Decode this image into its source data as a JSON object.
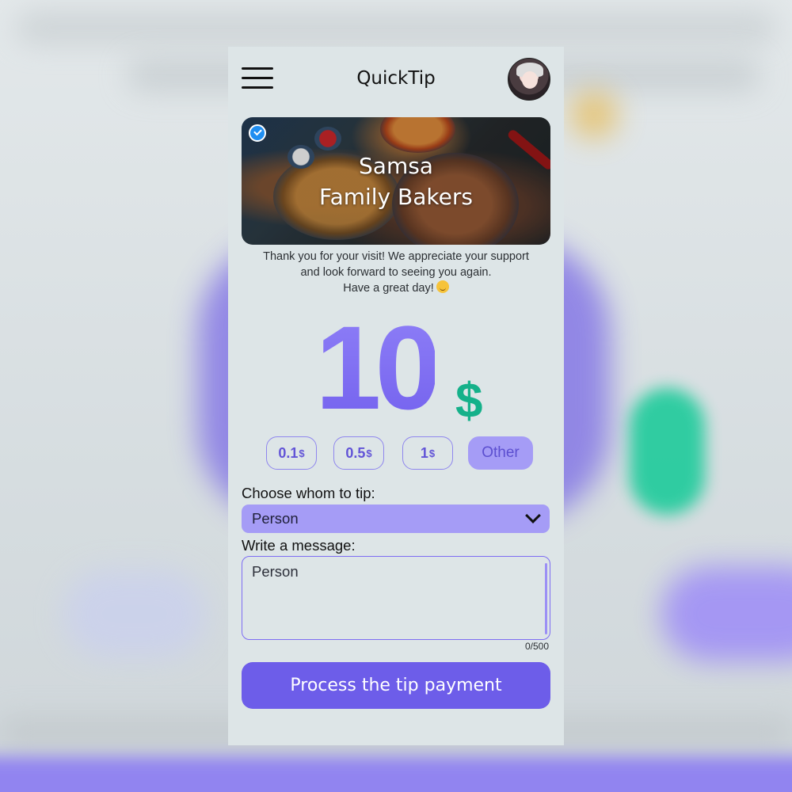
{
  "app": {
    "title": "QuickTip"
  },
  "header": {
    "menu_icon": "hamburger-menu-icon",
    "avatar_icon": "user-avatar"
  },
  "business": {
    "name_line1": "Samsa",
    "name_line2": "Family Bakers",
    "verified_icon": "verified-check-icon"
  },
  "message": {
    "line1": "Thank you for your visit! We appreciate your support",
    "line2": "and look forward to seeing you again.",
    "line3": "Have a great day!",
    "emoji_icon": "smiling-face-icon"
  },
  "tip": {
    "amount": "10",
    "currency": "$",
    "presets": [
      {
        "value": "0.1",
        "unit": "$"
      },
      {
        "value": "0.5",
        "unit": "$"
      },
      {
        "value": "1",
        "unit": "$"
      }
    ],
    "other_label": "Other"
  },
  "recipient": {
    "label": "Choose whom to tip:",
    "selected": "Person"
  },
  "note": {
    "label": "Write a message:",
    "value": "Person",
    "counter": "0/500"
  },
  "actions": {
    "pay_label": "Process the tip payment"
  },
  "colors": {
    "accent": "#6d5de9",
    "accent_light": "#a59cf6",
    "amount": "#7d6cf3",
    "currency": "#15b18a",
    "panel_bg": "#dde5e7"
  }
}
